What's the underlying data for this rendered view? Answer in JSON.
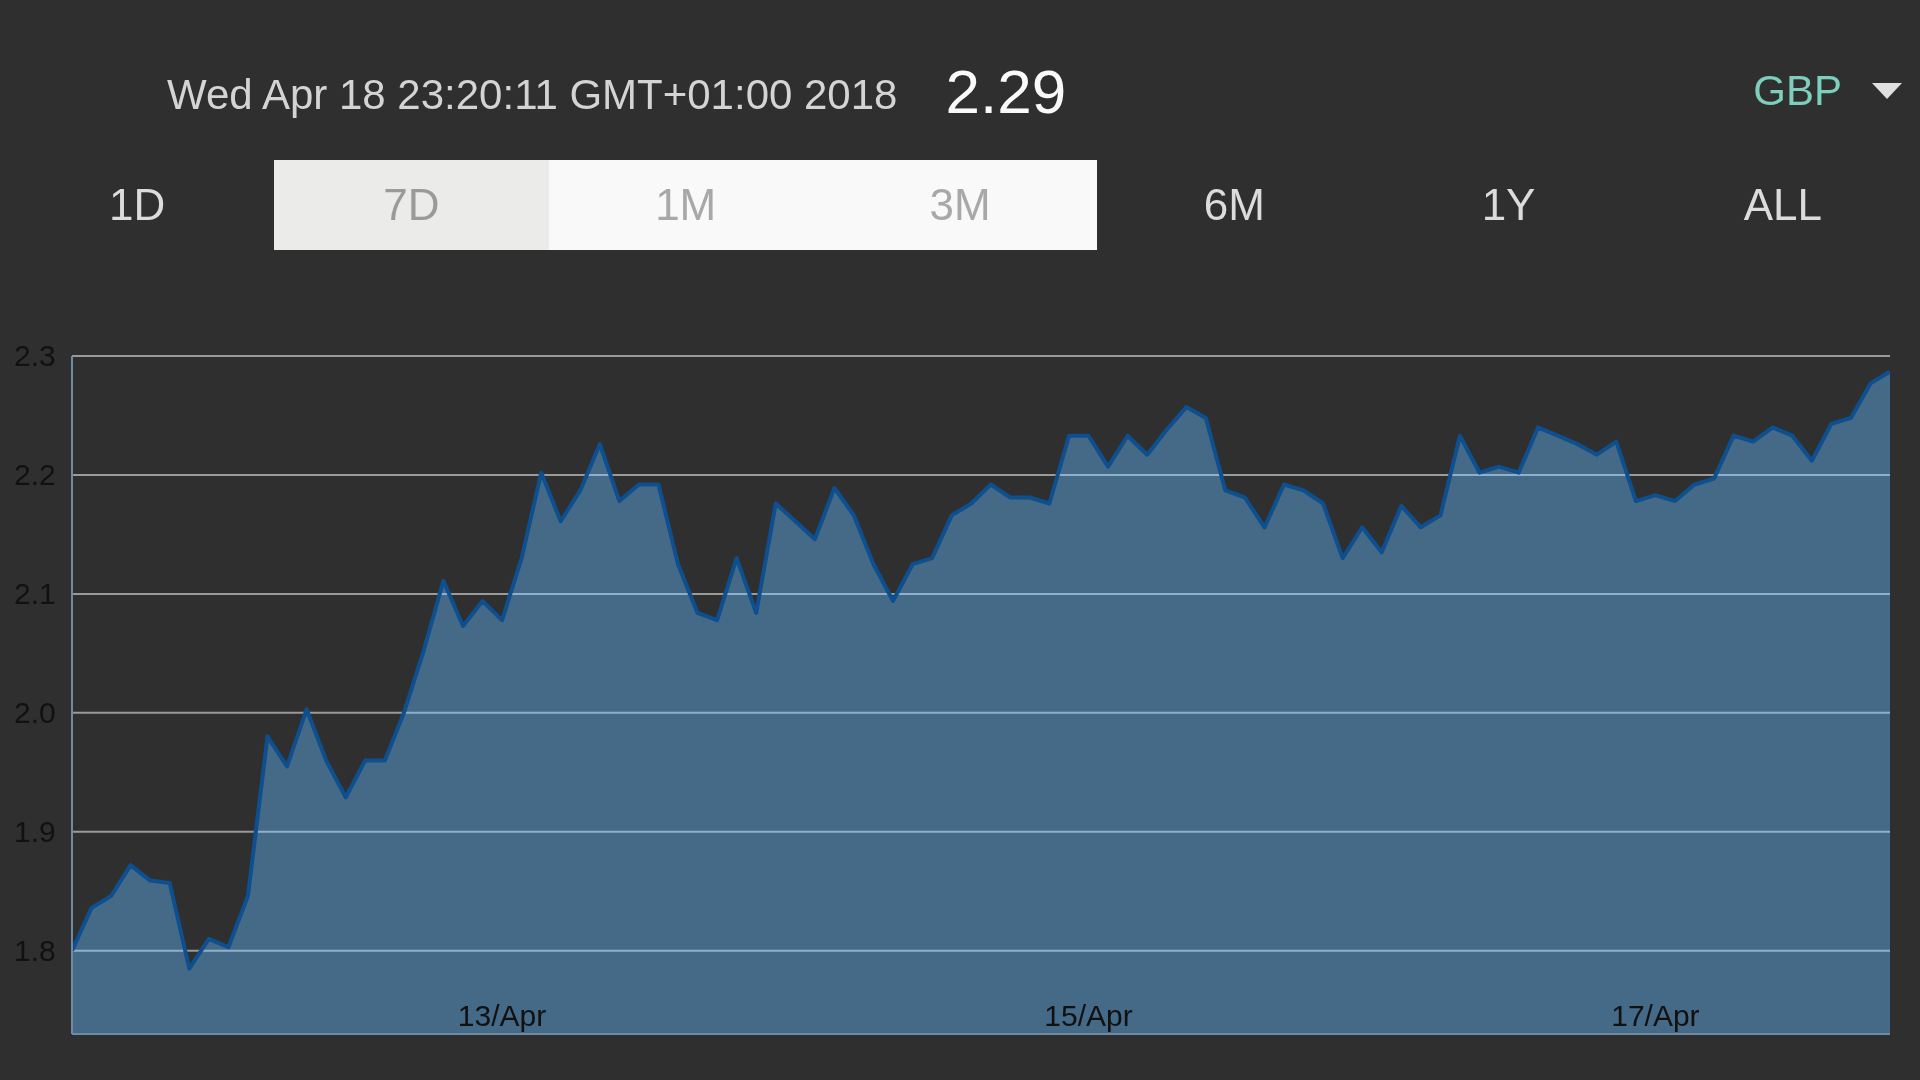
{
  "header": {
    "timestamp": "Wed Apr 18 23:20:11 GMT+01:00 2018",
    "price": "2.29",
    "currency": "GBP"
  },
  "tabs": [
    {
      "label": "1D",
      "selected": false,
      "highlighted": false
    },
    {
      "label": "7D",
      "selected": true,
      "highlighted": true
    },
    {
      "label": "1M",
      "selected": false,
      "highlighted": true
    },
    {
      "label": "3M",
      "selected": false,
      "highlighted": true
    },
    {
      "label": "6M",
      "selected": false,
      "highlighted": false
    },
    {
      "label": "1Y",
      "selected": false,
      "highlighted": false
    },
    {
      "label": "ALL",
      "selected": false,
      "highlighted": false
    }
  ],
  "chart": {
    "chart_data": {
      "type": "area",
      "grid": true,
      "ylim": [
        1.73,
        2.3
      ],
      "yticks": [
        {
          "value": 1.8,
          "label": "1.8"
        },
        {
          "value": 1.9,
          "label": "1.9"
        },
        {
          "value": 2.0,
          "label": "2.0"
        },
        {
          "value": 2.1,
          "label": "2.1"
        },
        {
          "value": 2.2,
          "label": "2.2"
        },
        {
          "value": 2.3,
          "label": "2.3"
        }
      ],
      "categories": [
        null,
        null,
        null,
        null,
        null,
        null,
        null,
        null,
        null,
        null,
        null,
        null,
        null,
        null,
        null,
        null,
        null,
        null,
        null,
        null,
        null,
        null,
        "13/Apr",
        null,
        null,
        null,
        null,
        null,
        null,
        null,
        null,
        null,
        null,
        null,
        null,
        null,
        null,
        null,
        null,
        null,
        null,
        null,
        null,
        null,
        null,
        null,
        null,
        null,
        null,
        null,
        null,
        null,
        "15/Apr",
        null,
        null,
        null,
        null,
        null,
        null,
        null,
        null,
        null,
        null,
        null,
        null,
        null,
        null,
        null,
        null,
        null,
        null,
        null,
        null,
        null,
        null,
        null,
        null,
        null,
        null,
        null,
        null,
        "17/Apr",
        null,
        null,
        null,
        null,
        null,
        null,
        null,
        null,
        null,
        null,
        null,
        null
      ],
      "series": [
        {
          "color": "#0d4f8f",
          "values": [
            1.8,
            1.836,
            1.846,
            1.872,
            1.859,
            1.857,
            1.785,
            1.81,
            1.803,
            1.846,
            1.98,
            1.955,
            2.003,
            1.96,
            1.929,
            1.96,
            1.96,
            2.001,
            2.053,
            2.111,
            2.073,
            2.094,
            2.078,
            2.13,
            2.202,
            2.161,
            2.187,
            2.226,
            2.178,
            2.192,
            2.192,
            2.125,
            2.084,
            2.078,
            2.13,
            2.084,
            2.176,
            2.161,
            2.146,
            2.189,
            2.166,
            2.125,
            2.094,
            2.125,
            2.13,
            2.166,
            2.176,
            2.192,
            2.181,
            2.181,
            2.176,
            2.233,
            2.233,
            2.207,
            2.233,
            2.217,
            2.238,
            2.257,
            2.248,
            2.187,
            2.181,
            2.156,
            2.192,
            2.187,
            2.176,
            2.13,
            2.156,
            2.135,
            2.174,
            2.156,
            2.166,
            2.233,
            2.202,
            2.207,
            2.202,
            2.24,
            2.233,
            2.226,
            2.217,
            2.228,
            2.178,
            2.183,
            2.178,
            2.192,
            2.197,
            2.233,
            2.228,
            2.24,
            2.233,
            2.212,
            2.243,
            2.248,
            2.277,
            2.287
          ]
        }
      ]
    }
  }
}
